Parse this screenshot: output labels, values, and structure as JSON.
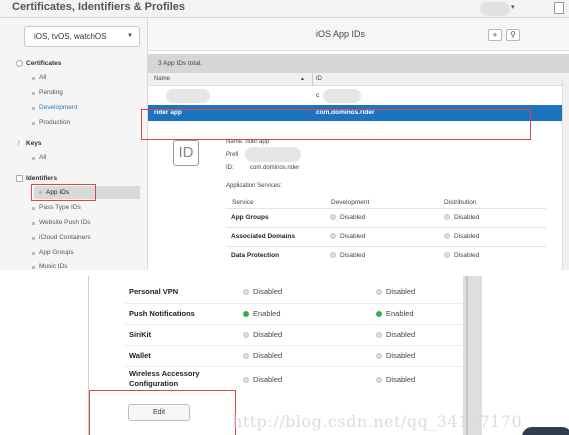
{
  "header": {
    "title": "Certificates, Identifiers & Profiles",
    "user_caret": "▾"
  },
  "sidebar": {
    "platform": "iOS, tvOS, watchOS",
    "certificates": {
      "label": "Certificates",
      "items": [
        "All",
        "Pending",
        "Development",
        "Production"
      ]
    },
    "keys": {
      "label": "Keys",
      "items": [
        "All"
      ]
    },
    "identifiers": {
      "label": "Identifiers",
      "items": [
        "App IDs",
        "Pass Type IDs",
        "Website Push IDs",
        "iCloud Containers",
        "App Groups",
        "Music IDs"
      ]
    }
  },
  "main": {
    "title": "iOS App IDs",
    "add_label": "+",
    "search_label": "⚲",
    "total": "3  App IDs total.",
    "columns": {
      "name": "Name",
      "id": "ID"
    },
    "rows": [
      {
        "name": "",
        "id": "c"
      },
      {
        "name": "rider app",
        "id": "com.dominos.rider"
      }
    ],
    "detail": {
      "icon_label": "ID",
      "name_label": "Name:",
      "name_value": "rider app",
      "prefix_label": "Prefi",
      "id_label": "ID:",
      "id_value": "com.dominos.rider",
      "services_title": "Application Services:"
    },
    "services": {
      "headers": [
        "Service",
        "Development",
        "Distribution"
      ],
      "rows": [
        {
          "name": "App Groups",
          "dev": "Disabled",
          "dist": "Disabled"
        },
        {
          "name": "Associated Domains",
          "dev": "Disabled",
          "dist": "Disabled"
        },
        {
          "name": "Data Protection",
          "dev": "Disabled",
          "dist": "Disabled"
        }
      ]
    }
  },
  "bottom": {
    "rows": [
      {
        "name": "Personal VPN",
        "dev": "Disabled",
        "dist": "Disabled",
        "dev_on": false,
        "dist_on": false
      },
      {
        "name": "Push Notifications",
        "dev": "Enabled",
        "dist": "Enabled",
        "dev_on": true,
        "dist_on": true
      },
      {
        "name": "SiriKit",
        "dev": "Disabled",
        "dist": "Disabled",
        "dev_on": false,
        "dist_on": false
      },
      {
        "name": "Wallet",
        "dev": "Disabled",
        "dist": "Disabled",
        "dev_on": false,
        "dist_on": false
      },
      {
        "name": "Wireless Accessory",
        "name2": "Configuration",
        "dev": "Disabled",
        "dist": "Disabled",
        "dev_on": false,
        "dist_on": false
      }
    ],
    "edit_label": "Edit"
  },
  "watermark": "http://blog.csdn.net/qq_34117170",
  "colors": {
    "selection": "#1e73be",
    "enabled": "#2fb14a",
    "disabled": "#dddddd",
    "highlight_box": "#d24a4a",
    "sidebar_active": "#2c79c0"
  }
}
